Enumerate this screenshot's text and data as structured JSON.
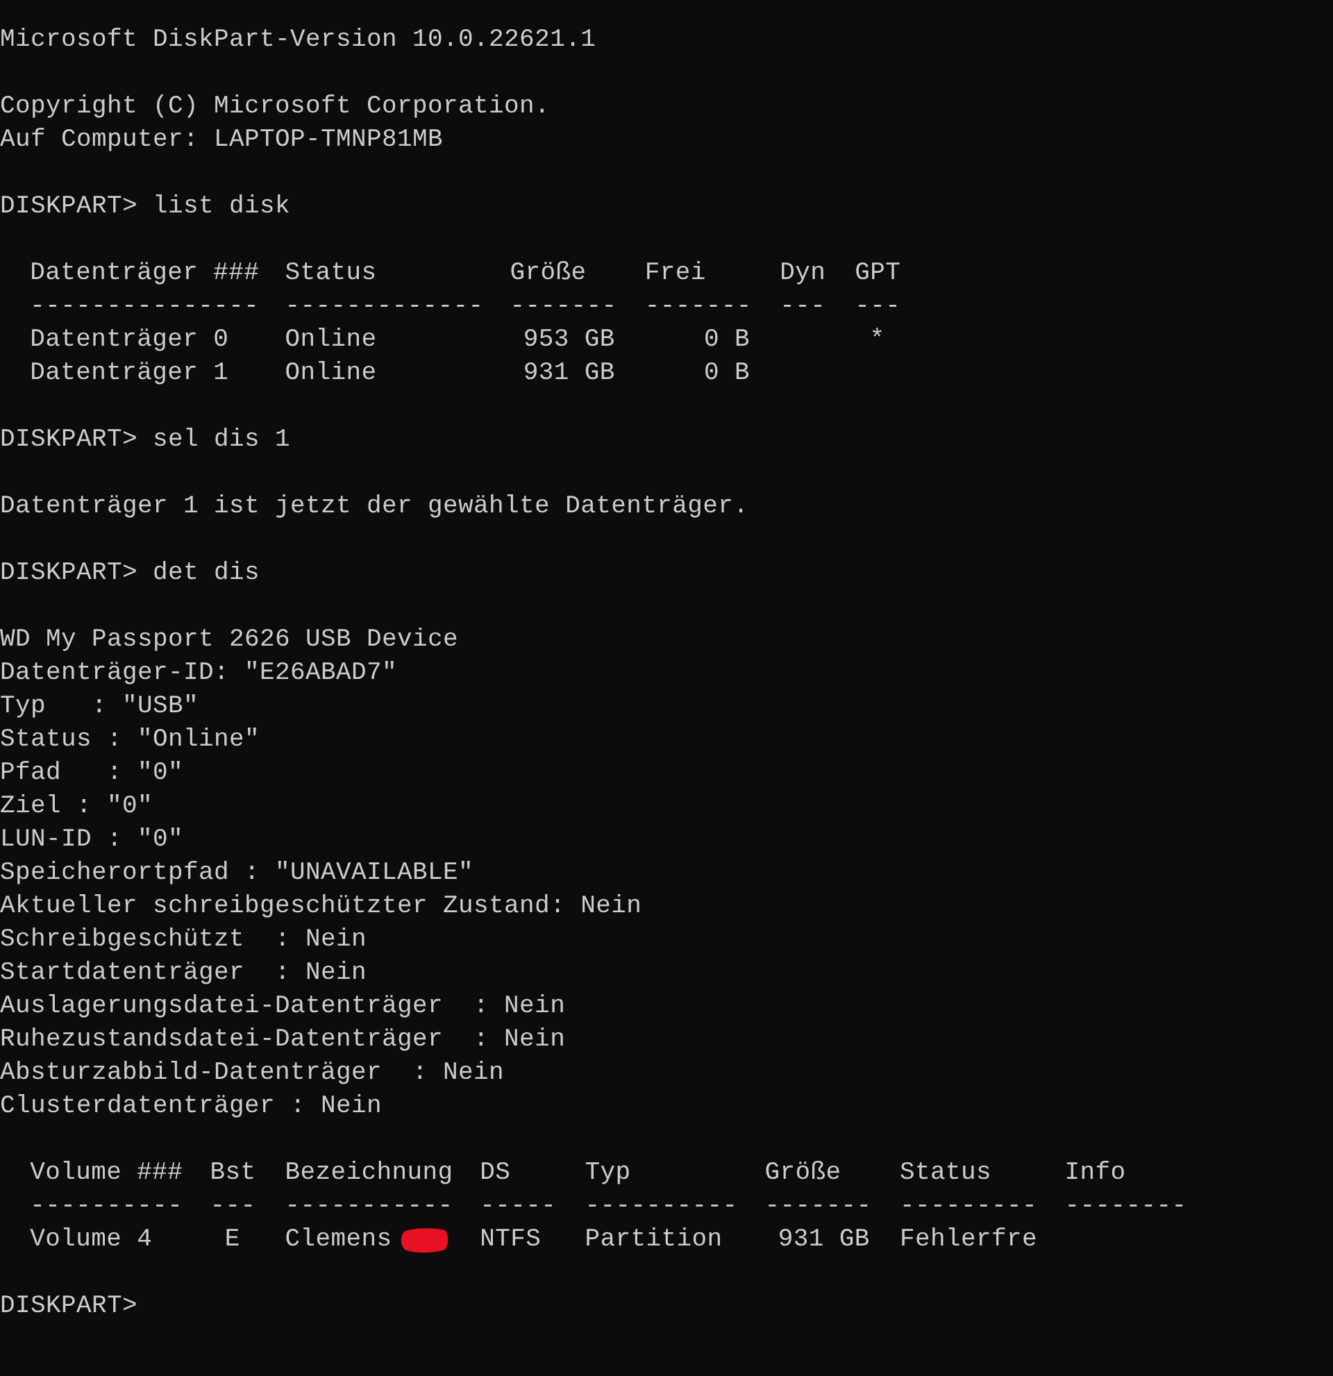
{
  "console": {
    "lines": [
      {
        "kind": "text",
        "text": "Microsoft DiskPart-Version 10.0.22621.1"
      },
      {
        "kind": "blank"
      },
      {
        "kind": "text",
        "text": "Copyright (C) Microsoft Corporation."
      },
      {
        "kind": "text",
        "text": "Auf Computer: LAPTOP-TMNP81MB"
      },
      {
        "kind": "blank"
      },
      {
        "kind": "prompt",
        "text": "DISKPART> list disk"
      },
      {
        "kind": "blank"
      },
      {
        "kind": "table",
        "columns": [
          {
            "header": "Datenträger ###",
            "rule": "---------------",
            "kind": "label"
          },
          {
            "header": "Status",
            "rule": "-------------",
            "kind": "label"
          },
          {
            "header": "Größe",
            "rule": "-------",
            "kind": "number"
          },
          {
            "header": "Frei",
            "rule": "-------",
            "kind": "number"
          },
          {
            "header": "Dyn",
            "rule": "---",
            "kind": "label"
          },
          {
            "header": "GPT",
            "rule": "---",
            "kind": "mark"
          }
        ],
        "rows": [
          {
            "cells": [
              {
                "text": "Datenträger 0"
              },
              {
                "text": "Online"
              },
              {
                "text": "953 GB"
              },
              {
                "text": "0 B"
              },
              {},
              {
                "text": "*"
              }
            ]
          },
          {
            "cells": [
              {
                "text": "Datenträger 1"
              },
              {
                "text": "Online"
              },
              {
                "text": "931 GB"
              },
              {
                "text": "0 B"
              },
              {},
              {}
            ]
          }
        ]
      },
      {
        "kind": "blank"
      },
      {
        "kind": "prompt",
        "text": "DISKPART> sel dis 1"
      },
      {
        "kind": "blank"
      },
      {
        "kind": "text",
        "text": "Datenträger 1 ist jetzt der gewählte Datenträger."
      },
      {
        "kind": "blank"
      },
      {
        "kind": "prompt",
        "text": "DISKPART> det dis"
      },
      {
        "kind": "blank"
      },
      {
        "kind": "text",
        "text": "WD My Passport 2626 USB Device"
      },
      {
        "kind": "text",
        "text": "Datenträger-ID: \"E26ABAD7\""
      },
      {
        "kind": "text",
        "text": "Typ   : \"USB\""
      },
      {
        "kind": "text",
        "text": "Status : \"Online\""
      },
      {
        "kind": "text",
        "text": "Pfad   : \"0\""
      },
      {
        "kind": "text",
        "text": "Ziel : \"0\""
      },
      {
        "kind": "text",
        "text": "LUN-ID : \"0\""
      },
      {
        "kind": "text",
        "text": "Speicherortpfad : \"UNAVAILABLE\""
      },
      {
        "kind": "text",
        "text": "Aktueller schreibgeschützter Zustand: Nein"
      },
      {
        "kind": "text",
        "text": "Schreibgeschützt  : Nein"
      },
      {
        "kind": "text",
        "text": "Startdatenträger  : Nein"
      },
      {
        "kind": "text",
        "text": "Auslagerungsdatei-Datenträger  : Nein"
      },
      {
        "kind": "text",
        "text": "Ruhezustandsdatei-Datenträger  : Nein"
      },
      {
        "kind": "text",
        "text": "Absturzabbild-Datenträger  : Nein"
      },
      {
        "kind": "text",
        "text": "Clusterdatenträger : Nein"
      },
      {
        "kind": "blank"
      },
      {
        "kind": "table",
        "columns": [
          {
            "header": "Volume ###",
            "rule": "----------",
            "kind": "label"
          },
          {
            "header": "Bst",
            "rule": "---",
            "kind": "mark"
          },
          {
            "header": "Bezeichnung",
            "rule": "-----------",
            "kind": "label"
          },
          {
            "header": "DS",
            "rule": "-----",
            "kind": "label"
          },
          {
            "header": "Typ",
            "rule": "----------",
            "kind": "label"
          },
          {
            "header": "Größe",
            "rule": "-------",
            "kind": "number"
          },
          {
            "header": "Status",
            "rule": "---------",
            "kind": "label"
          },
          {
            "header": "Info",
            "rule": "--------",
            "kind": "label"
          }
        ],
        "rows": [
          {
            "cells": [
              {
                "text": "Volume 4"
              },
              {
                "text": "E"
              },
              {
                "text": "Clemens",
                "redacted": true
              },
              {
                "text": "NTFS"
              },
              {
                "text": "Partition"
              },
              {
                "text": "931 GB"
              },
              {
                "text": "Fehlerfre"
              },
              {}
            ]
          }
        ]
      },
      {
        "kind": "blank"
      },
      {
        "kind": "prompt",
        "text": "DISKPART>"
      }
    ]
  }
}
